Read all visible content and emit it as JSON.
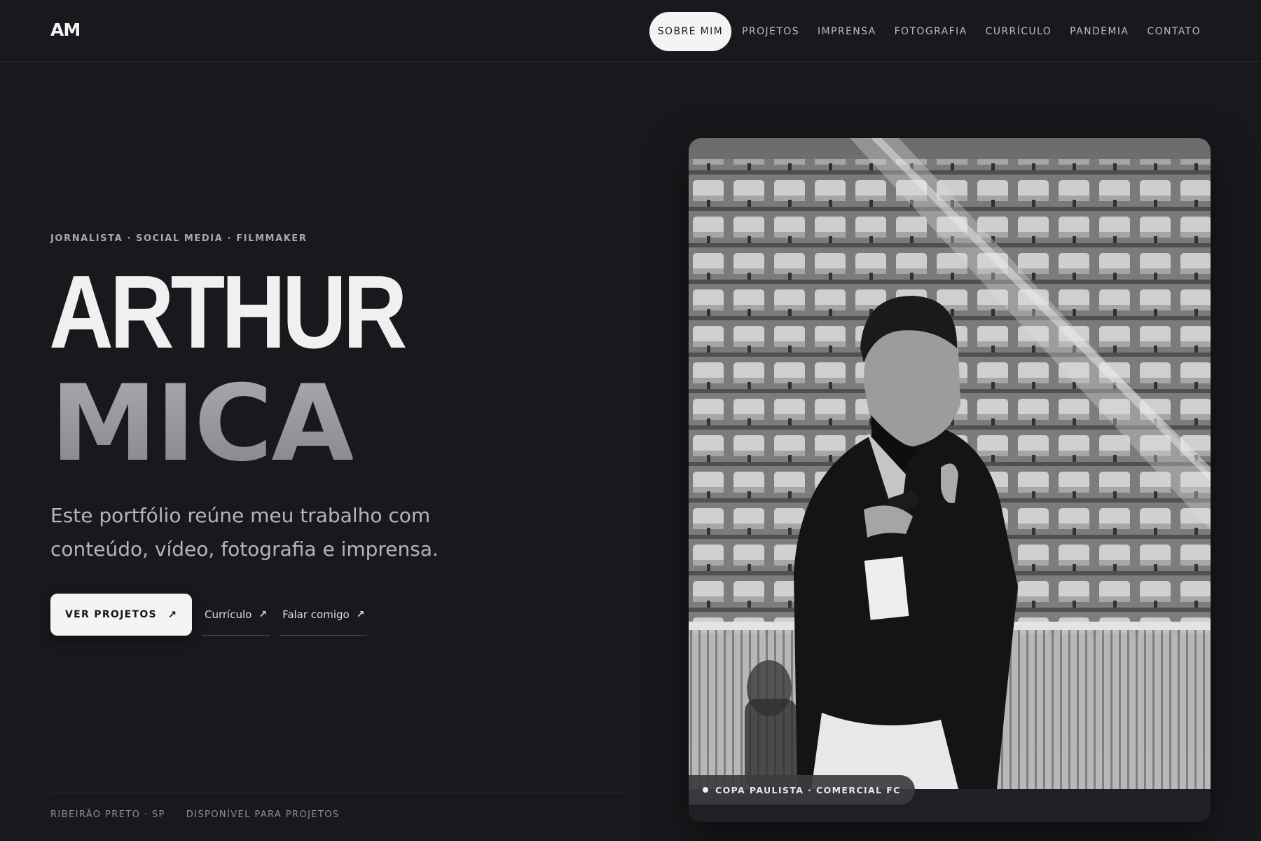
{
  "brand": {
    "logo": "AM"
  },
  "nav": {
    "items": [
      {
        "label": "SOBRE MIM",
        "active": true
      },
      {
        "label": "PROJETOS"
      },
      {
        "label": "IMPRENSA"
      },
      {
        "label": "FOTOGRAFIA"
      },
      {
        "label": "CURRÍCULO"
      },
      {
        "label": "PANDEMIA"
      },
      {
        "label": "CONTATO"
      }
    ]
  },
  "hero": {
    "eyebrow": "JORNALISTA · SOCIAL MEDIA · FILMMAKER",
    "first_name": "ARTHUR",
    "last_name": "MICA",
    "intro": "Este portfólio reúne meu trabalho com conteúdo, vídeo, fotografia e imprensa.",
    "cta_primary": "VER PROJETOS",
    "cta_resume": "Currículo",
    "cta_contact": "Falar comigo",
    "arrow_glyph": "↗"
  },
  "footer": {
    "location": "RIBEIRÃO PRETO · SP",
    "availability": "DISPONÍVEL PARA PROJETOS"
  },
  "photo": {
    "caption": "COPA PAULISTA · COMERCIAL FC"
  },
  "colors": {
    "background": "#18191c",
    "text_primary": "#f0f0f1",
    "text_muted": "#b4b5b8",
    "button_bg": "#f4f4f5"
  }
}
